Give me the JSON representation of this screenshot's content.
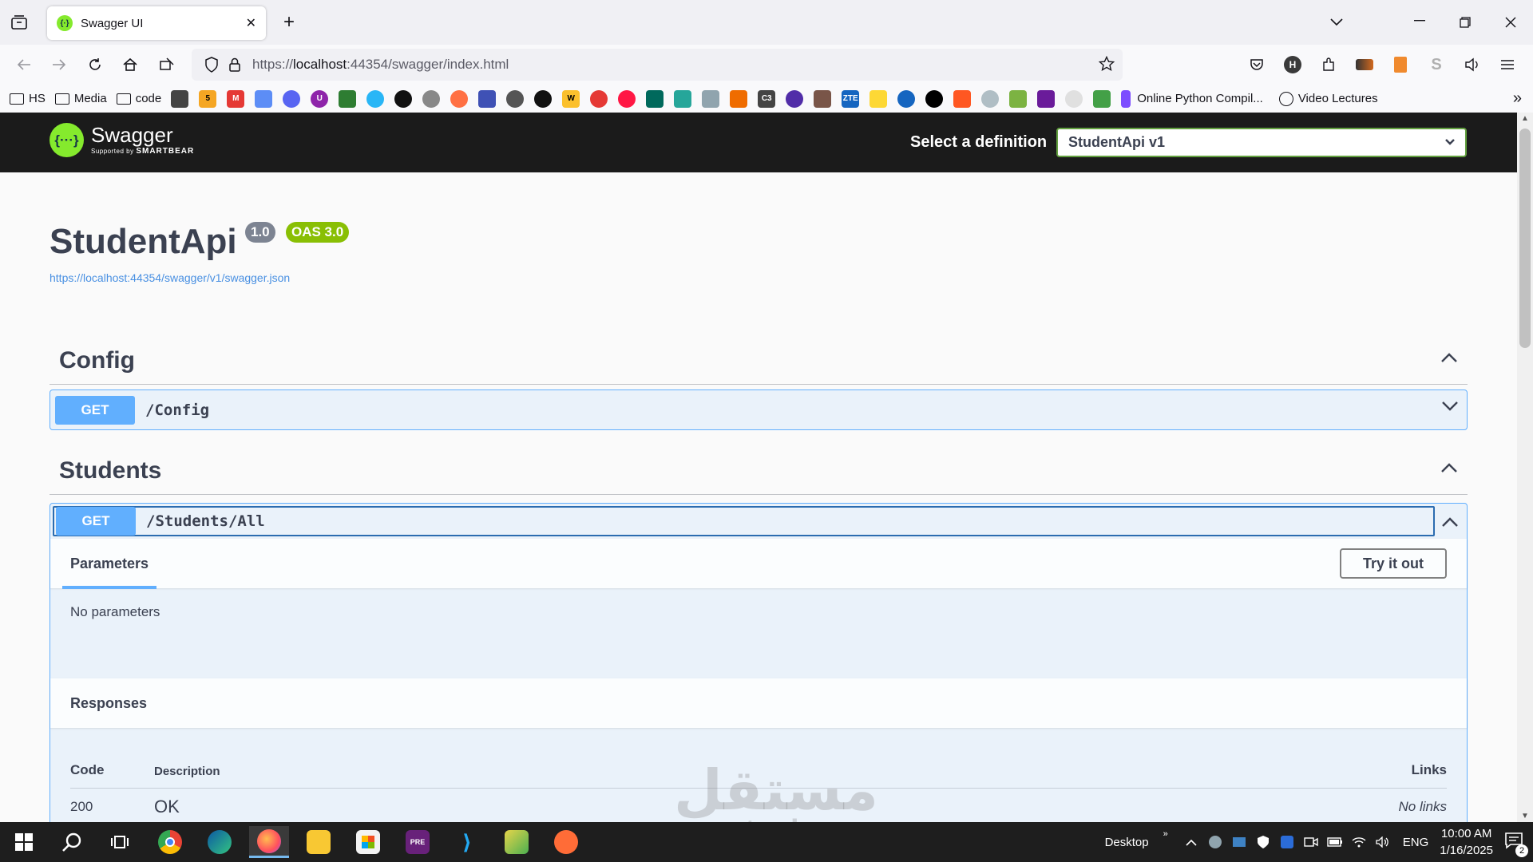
{
  "browser": {
    "tab_title": "Swagger UI",
    "url_prefix": "https://",
    "url_host": "localhost",
    "url_rest": ":44354/swagger/index.html",
    "bookmarks_folders": [
      "HS",
      "Media",
      "code"
    ],
    "bookmark_right_1": "Online Python Compil...",
    "bookmark_right_2": "Video Lectures"
  },
  "swagger": {
    "brand": "Swagger",
    "supported_by": "Supported by",
    "smartbear": "SMARTBEAR",
    "select_label": "Select a definition",
    "selected_definition": "StudentApi v1",
    "api_title": "StudentApi",
    "version_badge": "1.0",
    "oas_badge": "OAS 3.0",
    "spec_link": "https://localhost:44354/swagger/v1/swagger.json",
    "tags": [
      {
        "name": "Config",
        "method": "GET",
        "path": "/Config"
      },
      {
        "name": "Students",
        "method": "GET",
        "path": "/Students/All"
      }
    ],
    "parameters_tab": "Parameters",
    "try_it_out": "Try it out",
    "no_parameters": "No parameters",
    "responses_title": "Responses",
    "col_code": "Code",
    "col_description": "Description",
    "col_links": "Links",
    "response_code": "200",
    "response_desc": "OK",
    "response_links": "No links"
  },
  "watermark": {
    "arabic": "مستقل",
    "latin": "mostaql.com"
  },
  "taskbar": {
    "desktop_label": "Desktop",
    "lang": "ENG",
    "time": "10:00 AM",
    "date": "1/16/2025",
    "notification_count": "2"
  }
}
